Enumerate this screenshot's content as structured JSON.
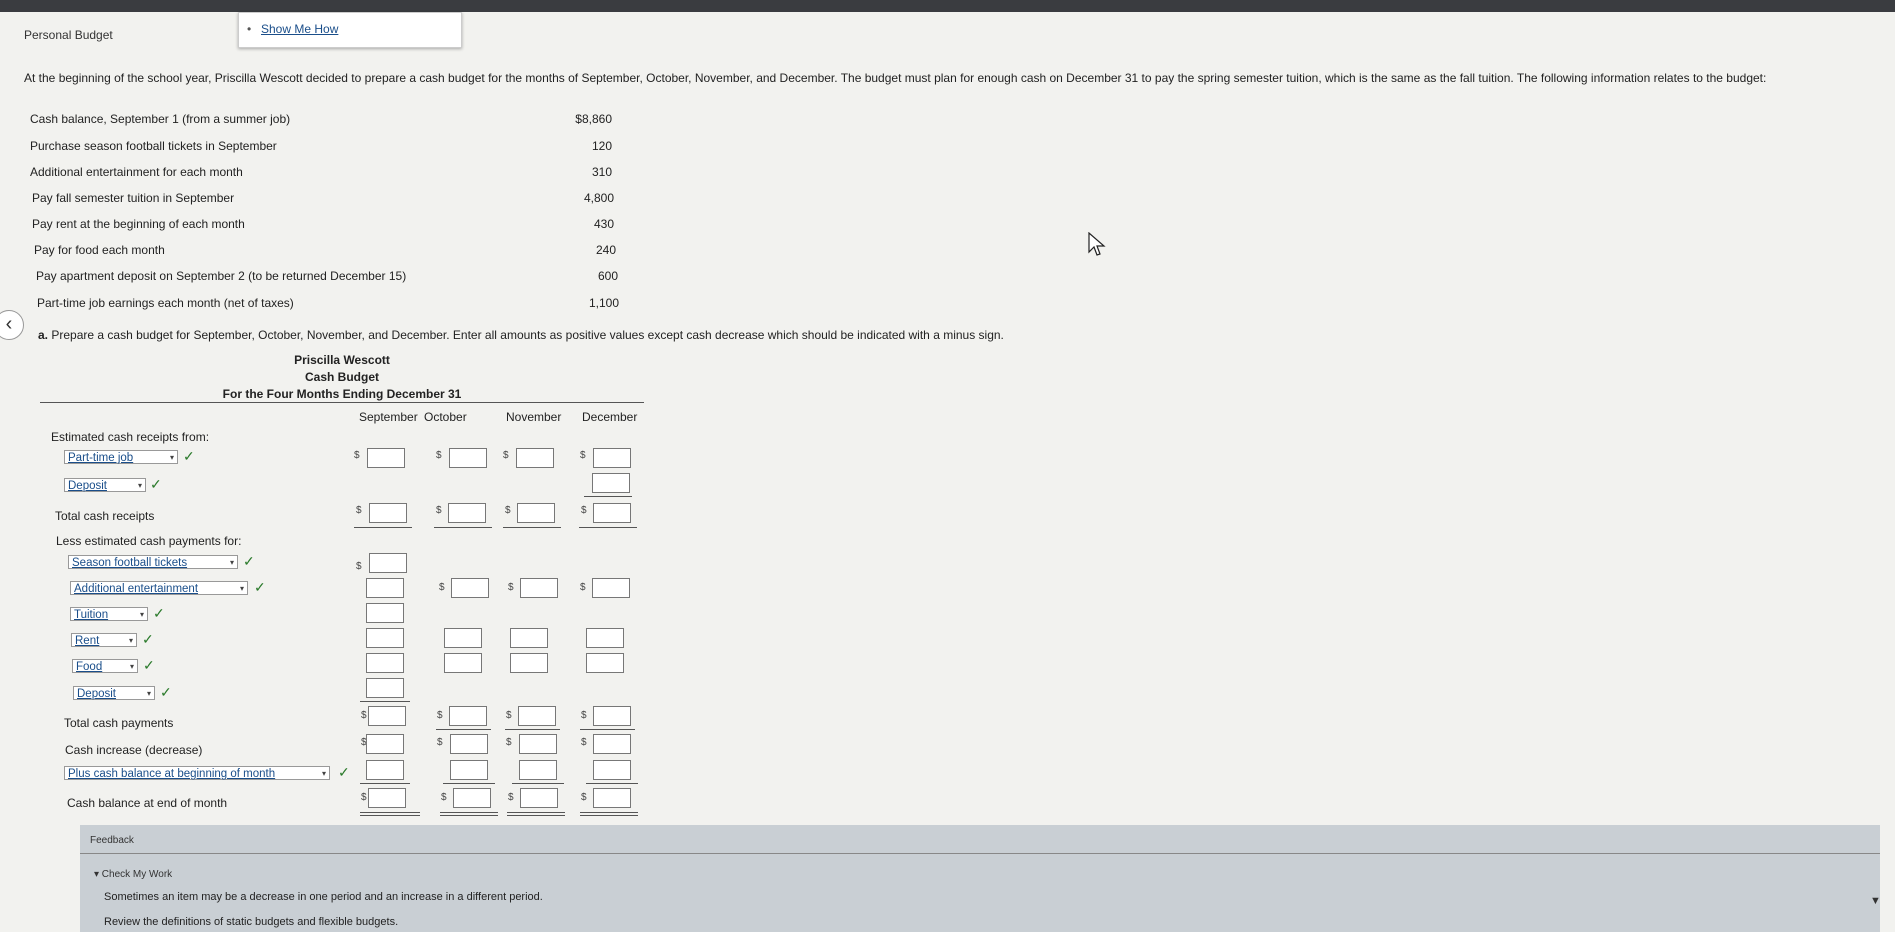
{
  "header": {
    "title": "Personal Budget",
    "show_me_how": "Show Me How",
    "bullet": "•"
  },
  "intro": "At the beginning of the school year, Priscilla Wescott decided to prepare a cash budget for the months of September, October, November, and December. The budget must plan for enough cash on December 31 to pay the spring semester tuition, which is the same as the fall tuition. The following information relates to the budget:",
  "info": [
    {
      "label": "Cash balance, September 1 (from a summer job)",
      "value": "$8,860"
    },
    {
      "label": "Purchase season football tickets in September",
      "value": "120"
    },
    {
      "label": "Additional entertainment for each month",
      "value": "310"
    },
    {
      "label": "Pay fall semester tuition in September",
      "value": "4,800"
    },
    {
      "label": "Pay rent at the beginning of each month",
      "value": "430"
    },
    {
      "label": "Pay for food each month",
      "value": "240"
    },
    {
      "label": "Pay apartment deposit on September 2 (to be returned December 15)",
      "value": "600"
    },
    {
      "label": "Part-time job earnings each month (net of taxes)",
      "value": "1,100"
    }
  ],
  "question": {
    "letter": "a.",
    "text": "Prepare a cash budget for September, October, November, and December. Enter all amounts as positive values except cash decrease which should be indicated with a minus sign."
  },
  "budget": {
    "company": "Priscilla Wescott",
    "statement": "Cash Budget",
    "period": "For the Four Months Ending December 31",
    "columns": [
      "September",
      "October",
      "November",
      "December"
    ],
    "receipts_heading": "Estimated cash receipts from:",
    "sel_parttime": "Part-time job",
    "sel_deposit_in": "Deposit",
    "total_receipts": "Total cash receipts",
    "payments_heading": "Less estimated cash payments for:",
    "sel_football": "Season football tickets",
    "sel_entertainment": "Additional entertainment",
    "sel_tuition": "Tuition",
    "sel_rent": "Rent",
    "sel_food": "Food",
    "sel_deposit_out": "Deposit",
    "total_payments": "Total cash payments",
    "increase": "Cash increase (decrease)",
    "sel_plus_balance": "Plus cash balance at beginning of month",
    "end_balance": "Cash balance at end of month",
    "dollar": "$",
    "check": "✓",
    "arrow": "▾"
  },
  "feedback": {
    "title": "Feedback",
    "check_my_work": "▾ Check My Work",
    "line1": "Sometimes an item may be a decrease in one period and an increase in a different period.",
    "line2": "Review the definitions of static budgets and flexible budgets."
  },
  "nav": {
    "back": "‹",
    "scroll_down": "▼"
  }
}
